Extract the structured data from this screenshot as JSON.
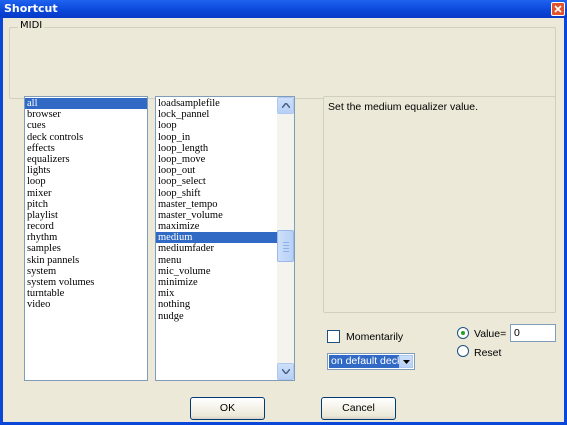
{
  "window": {
    "title": "Shortcut"
  },
  "midi_group": {
    "label": "MIDI"
  },
  "categories": {
    "items": [
      "all",
      "browser",
      "cues",
      "deck controls",
      "effects",
      "equalizers",
      "lights",
      "loop",
      "mixer",
      "pitch",
      "playlist",
      "record",
      "rhythm",
      "samples",
      "skin pannels",
      "system",
      "system volumes",
      "turntable",
      "video"
    ],
    "selected": "all"
  },
  "actions": {
    "items": [
      "loadsamplefile",
      "lock_pannel",
      "loop",
      "loop_in",
      "loop_length",
      "loop_move",
      "loop_out",
      "loop_select",
      "loop_shift",
      "master_tempo",
      "master_volume",
      "maximize",
      "medium",
      "mediumfader",
      "menu",
      "mic_volume",
      "minimize",
      "mix",
      "nothing",
      "nudge"
    ],
    "selected": "medium"
  },
  "description": {
    "text": "Set the medium equalizer value."
  },
  "options": {
    "momentarily_label": "Momentarily",
    "momentarily_checked": false,
    "value_label": "Value=",
    "value": "0",
    "reset_label": "Reset",
    "selected_mode": "value",
    "deck_select": "on default deck"
  },
  "buttons": {
    "ok": "OK",
    "cancel": "Cancel"
  },
  "colors": {
    "selection": "#316ac5",
    "titlebar": "#0a46d8",
    "dialog_bg": "#ece9d8"
  }
}
